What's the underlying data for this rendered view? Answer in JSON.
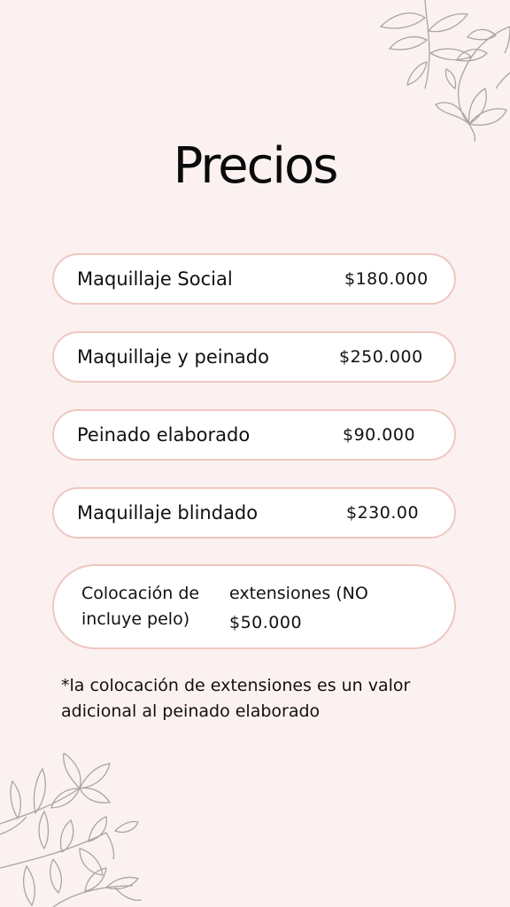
{
  "page": {
    "title": "Precios"
  },
  "prices": [
    {
      "name": "Maquillaje Social",
      "price": "$180.000"
    },
    {
      "name": "Maquillaje y peinado",
      "price": "$250.000"
    },
    {
      "name": "Peinado elaborado",
      "price": "$90.000"
    },
    {
      "name": "Maquillaje blindado",
      "price": "$230.00"
    }
  ],
  "extensions": {
    "line1_left": "Colocación de",
    "line1_right": "extensiones (NO",
    "line2_left": "incluye pelo)",
    "line2_right": "$50.000"
  },
  "note": "*la colocación de extensiones es un valor adicional al peinado elaborado",
  "colors": {
    "background": "#fcf1f1",
    "pill_border": "#efc7c0",
    "pill_fill": "#ffffff",
    "floral_stroke": "#a9a4a4"
  },
  "decorations": [
    "floral-top-right",
    "floral-bottom-left"
  ]
}
